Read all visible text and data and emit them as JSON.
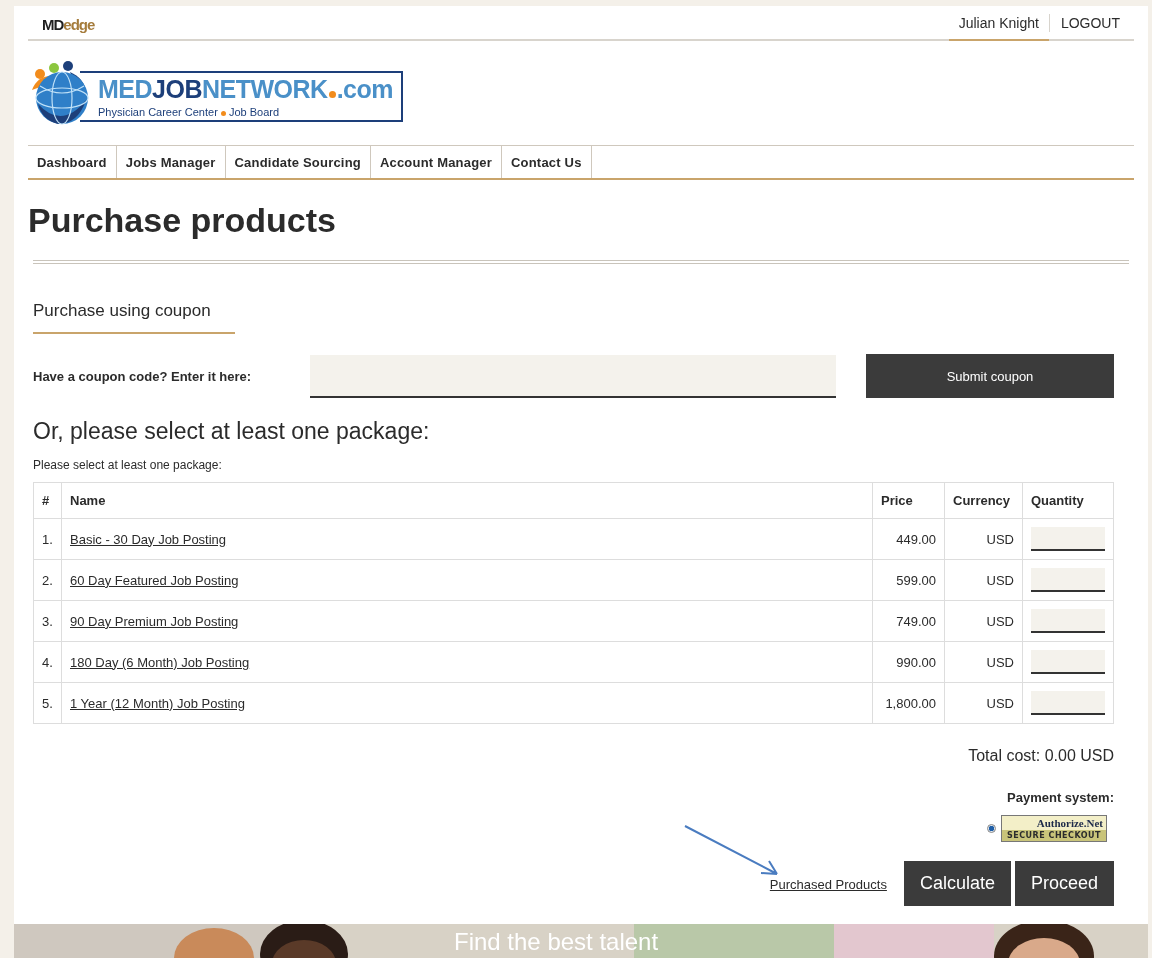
{
  "top_bar": {
    "brand": [
      {
        "text": "MD",
        "color": "#1f1f1f"
      },
      {
        "text": "edge",
        "color": "#a57c3c"
      }
    ],
    "user": "Julian Knight",
    "logout": "LOGOUT"
  },
  "logo": {
    "parts": [
      {
        "text": "MED",
        "color": "#4a90c8"
      },
      {
        "text": "JOB",
        "color": "#1d3f7a"
      },
      {
        "text": "NETWORK",
        "color": "#4a90c8"
      }
    ],
    "suffix": ".com",
    "tagline_left": "Physician Career Center",
    "tagline_right": "Job Board"
  },
  "nav": [
    {
      "label": "Dashboard"
    },
    {
      "label": "Jobs Manager"
    },
    {
      "label": "Candidate Sourcing"
    },
    {
      "label": "Account Manager"
    },
    {
      "label": "Contact Us"
    }
  ],
  "page_title": "Purchase products",
  "coupon": {
    "heading": "Purchase using coupon",
    "label": "Have a coupon code? Enter it here:",
    "button": "Submit coupon"
  },
  "packages": {
    "heading": "Or, please select at least one package:",
    "hint": "Please select at least one package:",
    "columns": [
      "#",
      "Name",
      "Price",
      "Currency",
      "Quantity"
    ],
    "rows": [
      {
        "index": "1.",
        "name": "Basic - 30 Day Job Posting",
        "price": "449.00",
        "currency": "USD"
      },
      {
        "index": "2.",
        "name": "60 Day Featured Job Posting",
        "price": "599.00",
        "currency": "USD"
      },
      {
        "index": "3.",
        "name": "90 Day Premium Job Posting",
        "price": "749.00",
        "currency": "USD"
      },
      {
        "index": "4.",
        "name": "180 Day (6 Month) Job Posting",
        "price": "990.00",
        "currency": "USD"
      },
      {
        "index": "5.",
        "name": "1 Year (12 Month) Job Posting",
        "price": "1,800.00",
        "currency": "USD"
      }
    ]
  },
  "total": "Total cost: 0.00 USD",
  "payment": {
    "label": "Payment system:",
    "options": [
      {
        "name": "Authorize.Net",
        "caption": "SECURE",
        "caption2": "CHECKOUT",
        "selected": true
      }
    ]
  },
  "actions": {
    "link": "Purchased Products",
    "buttons": [
      "Calculate",
      "Proceed"
    ]
  },
  "banner": {
    "kind": "picture",
    "headline": "Find the best talent"
  }
}
